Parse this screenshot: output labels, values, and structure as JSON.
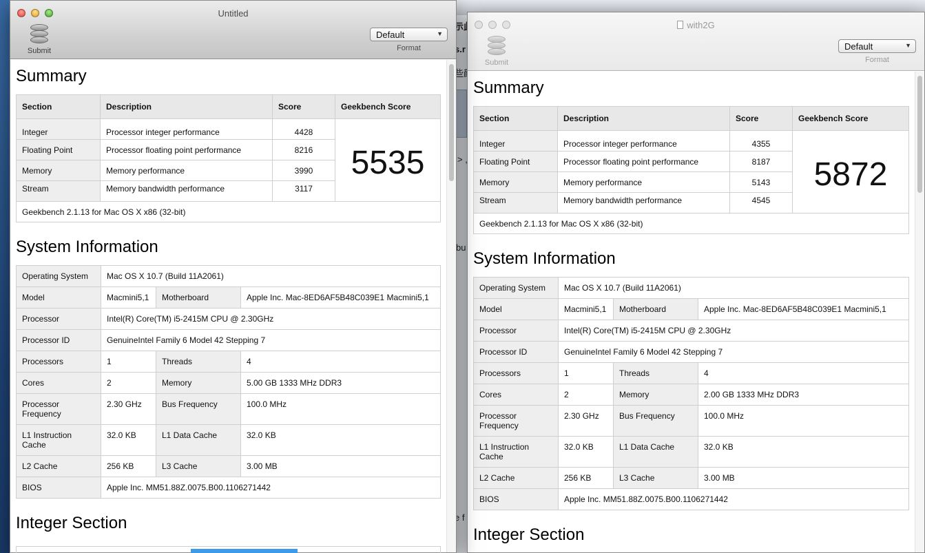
{
  "windows": [
    {
      "id": "untitled",
      "title": "Untitled",
      "toolbar": {
        "submit_label": "Submit",
        "format_value": "Default",
        "format_label": "Format"
      },
      "summary": {
        "heading": "Summary",
        "headers": [
          "Section",
          "Description",
          "Score",
          "Geekbench Score"
        ],
        "rows": [
          {
            "section": "Integer",
            "description": "Processor integer performance",
            "score": "4428"
          },
          {
            "section": "Floating Point",
            "description": "Processor floating point performance",
            "score": "8216"
          },
          {
            "section": "Memory",
            "description": "Memory performance",
            "score": "3990"
          },
          {
            "section": "Stream",
            "description": "Memory bandwidth performance",
            "score": "3117"
          }
        ],
        "geekbench_score": "5535",
        "footer": "Geekbench 2.1.13 for Mac OS X x86 (32-bit)"
      },
      "system": {
        "heading": "System Information",
        "operating_system_label": "Operating System",
        "operating_system": "Mac OS X 10.7 (Build 11A2061)",
        "model_label": "Model",
        "model": "Macmini5,1",
        "motherboard_label": "Motherboard",
        "motherboard": "Apple Inc. Mac-8ED6AF5B48C039E1 Macmini5,1",
        "processor_label": "Processor",
        "processor": "Intel(R) Core(TM) i5-2415M CPU @ 2.30GHz",
        "processor_id_label": "Processor ID",
        "processor_id": "GenuineIntel Family 6 Model 42 Stepping 7",
        "processors_label": "Processors",
        "processors": "1",
        "threads_label": "Threads",
        "threads": "4",
        "cores_label": "Cores",
        "cores": "2",
        "memory_label": "Memory",
        "memory": "5.00 GB  1333 MHz DDR3",
        "processor_frequency_label": "Processor Frequency",
        "processor_frequency": "2.30 GHz",
        "bus_frequency_label": "Bus Frequency",
        "bus_frequency": "100.0 MHz",
        "l1_instruction_cache_label": "L1 Instruction Cache",
        "l1_instruction_cache": "32.0 KB",
        "l1_data_cache_label": "L1 Data Cache",
        "l1_data_cache": "32.0 KB",
        "l2_cache_label": "L2 Cache",
        "l2_cache": "256 KB",
        "l3_cache_label": "L3 Cache",
        "l3_cache": "3.00 MB",
        "bios_label": "BIOS",
        "bios": "Apple Inc. MM51.88Z.0075.B00.1106271442"
      },
      "integer_section_heading": "Integer Section"
    },
    {
      "id": "with2g",
      "title": "with2G",
      "toolbar": {
        "submit_label": "Submit",
        "format_value": "Default",
        "format_label": "Format"
      },
      "summary": {
        "heading": "Summary",
        "headers": [
          "Section",
          "Description",
          "Score",
          "Geekbench Score"
        ],
        "rows": [
          {
            "section": "Integer",
            "description": "Processor integer performance",
            "score": "4355"
          },
          {
            "section": "Floating Point",
            "description": "Processor floating point performance",
            "score": "8187"
          },
          {
            "section": "Memory",
            "description": "Memory performance",
            "score": "5143"
          },
          {
            "section": "Stream",
            "description": "Memory bandwidth performance",
            "score": "4545"
          }
        ],
        "geekbench_score": "5872",
        "footer": "Geekbench 2.1.13 for Mac OS X x86 (32-bit)"
      },
      "system": {
        "heading": "System Information",
        "operating_system_label": "Operating System",
        "operating_system": "Mac OS X 10.7 (Build 11A2061)",
        "model_label": "Model",
        "model": "Macmini5,1",
        "motherboard_label": "Motherboard",
        "motherboard": "Apple Inc. Mac-8ED6AF5B48C039E1 Macmini5,1",
        "processor_label": "Processor",
        "processor": "Intel(R) Core(TM) i5-2415M CPU @ 2.30GHz",
        "processor_id_label": "Processor ID",
        "processor_id": "GenuineIntel Family 6 Model 42 Stepping 7",
        "processors_label": "Processors",
        "processors": "1",
        "threads_label": "Threads",
        "threads": "4",
        "cores_label": "Cores",
        "cores": "2",
        "memory_label": "Memory",
        "memory": "2.00 GB  1333 MHz DDR3",
        "processor_frequency_label": "Processor Frequency",
        "processor_frequency": "2.30 GHz",
        "bus_frequency_label": "Bus Frequency",
        "bus_frequency": "100.0 MHz",
        "l1_instruction_cache_label": "L1 Instruction Cache",
        "l1_instruction_cache": "32.0 KB",
        "l1_data_cache_label": "L1 Data Cache",
        "l1_data_cache": "32.0 KB",
        "l2_cache_label": "L2 Cache",
        "l2_cache": "256 KB",
        "l3_cache_label": "L3 Cache",
        "l3_cache": "3.00 MB",
        "bios_label": "BIOS",
        "bios": "Apple Inc. MM51.88Z.0075.B00.1106271442"
      },
      "integer_section_heading": "Integer Section"
    }
  ],
  "background_fragments": [
    "示此",
    "s.r",
    "些颜",
    "> ,",
    "bu",
    "e f"
  ],
  "colors": {
    "integer_bar": "#3d9ae8"
  }
}
